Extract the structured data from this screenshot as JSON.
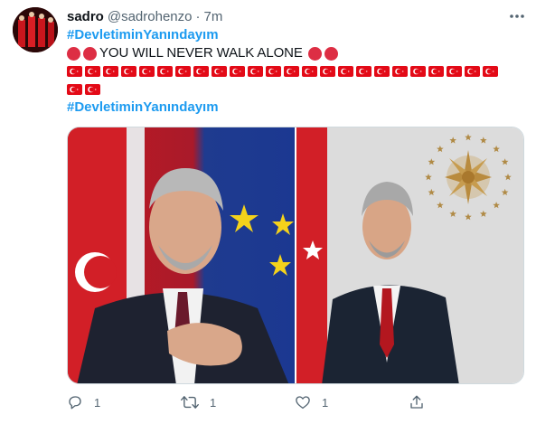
{
  "tweet": {
    "display_name": "sadro",
    "handle": "@sadrohenzo",
    "separator": "·",
    "time": "7m",
    "hashtag_top": "#DevletiminYanındayım",
    "message": "YOU WILL NEVER WALK ALONE",
    "hashtag_bottom": "#DevletiminYanındayım",
    "flag_count_row1": 24,
    "flag_count_row2": 2
  },
  "actions": {
    "reply_count": "1",
    "retweet_count": "1",
    "like_count": "1"
  },
  "icons": {
    "more": "more-horizontal-icon",
    "reply": "reply-icon",
    "retweet": "retweet-icon",
    "like": "heart-icon",
    "share": "share-icon"
  },
  "colors": {
    "hashtag": "#1d9bf0",
    "muted": "#536471",
    "red_circle": "#dd2e44",
    "flag_red": "#e30a17"
  }
}
